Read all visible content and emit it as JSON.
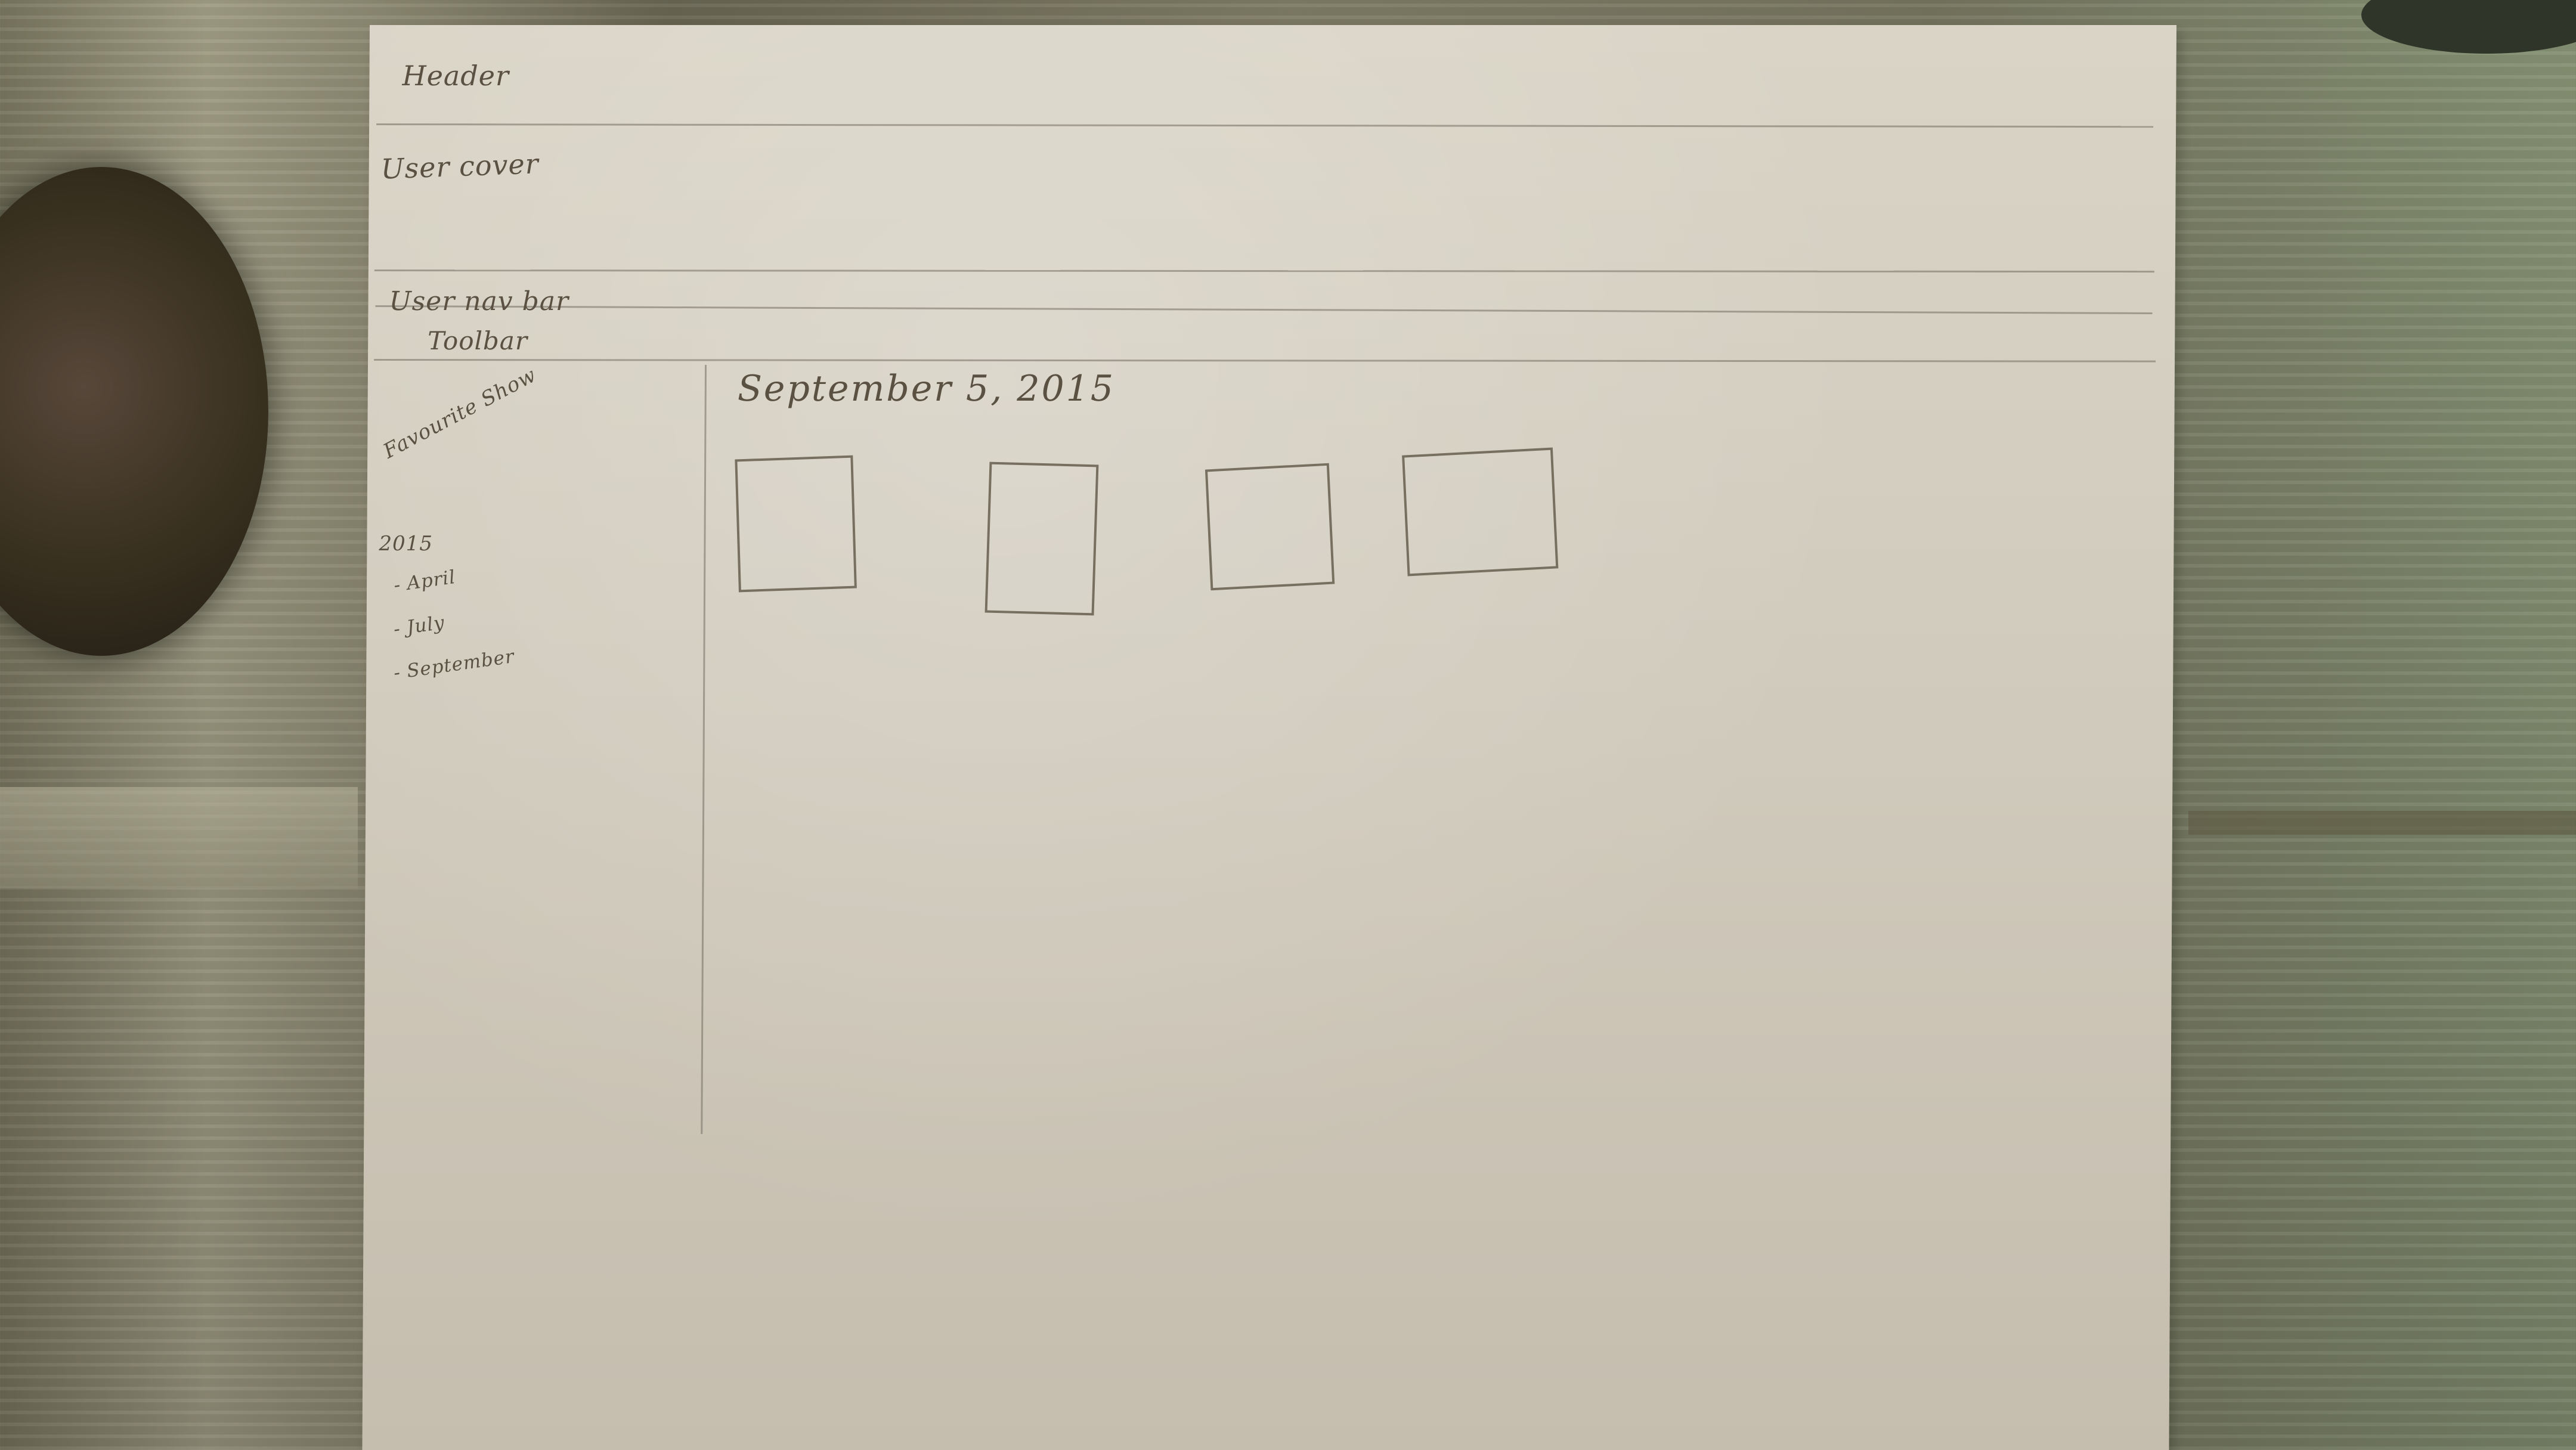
{
  "wireframe": {
    "header_label": "Header",
    "user_cover_label": "User cover",
    "user_navbar_label": "User nav bar",
    "toolbar_label": "Toolbar",
    "sidebar": {
      "section_label": "Favourite Show",
      "year": "2015",
      "months": [
        "- April",
        "- July",
        "- September"
      ]
    },
    "content": {
      "date_heading": "September 5, 2015"
    }
  },
  "colors": {
    "paper": "#d3cdbf",
    "pencil": "#5a5142"
  }
}
